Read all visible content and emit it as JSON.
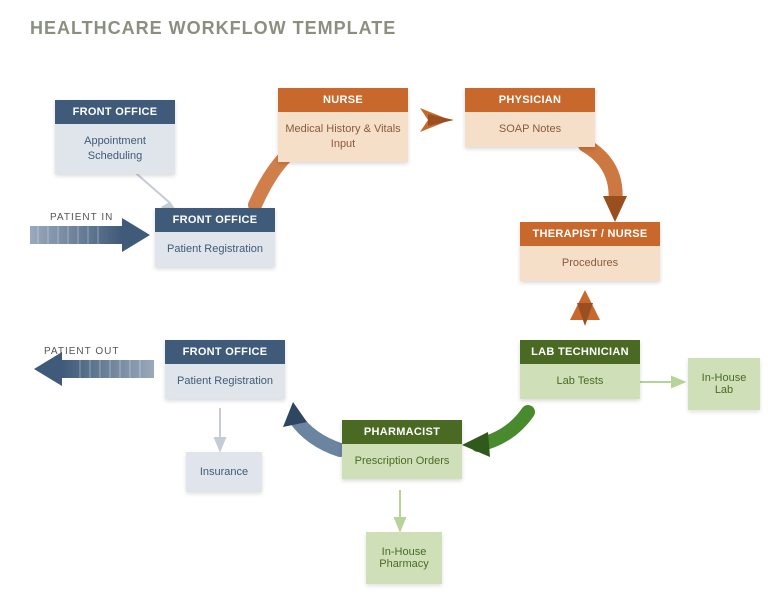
{
  "title": "HEALTHCARE WORKFLOW TEMPLATE",
  "labels": {
    "patient_in": "PATIENT IN",
    "patient_out": "PATIENT OUT"
  },
  "nodes": {
    "fo_appt": {
      "role": "FRONT OFFICE",
      "task": "Appointment Scheduling"
    },
    "fo_reg": {
      "role": "FRONT OFFICE",
      "task": "Patient Registration"
    },
    "nurse": {
      "role": "NURSE",
      "task": "Medical History & Vitals Input"
    },
    "physician": {
      "role": "PHYSICIAN",
      "task": "SOAP Notes"
    },
    "therapist": {
      "role": "THERAPIST / NURSE",
      "task": "Procedures"
    },
    "labtech": {
      "role": "LAB TECHNICIAN",
      "task": "Lab Tests"
    },
    "pharm": {
      "role": "PHARMACIST",
      "task": "Prescription Orders"
    },
    "fo_reg2": {
      "role": "FRONT OFFICE",
      "task": "Patient Registration"
    }
  },
  "aux": {
    "inhouse_lab": "In-House Lab",
    "inhouse_pharm": "In-House Pharmacy",
    "insurance": "Insurance"
  },
  "chart_data": {
    "type": "flowchart",
    "title": "HEALTHCARE WORKFLOW TEMPLATE",
    "entry_label": "PATIENT IN",
    "exit_label": "PATIENT OUT",
    "nodes": [
      {
        "id": "fo_appt",
        "role": "FRONT OFFICE",
        "task": "Appointment Scheduling",
        "group": "blue"
      },
      {
        "id": "fo_reg",
        "role": "FRONT OFFICE",
        "task": "Patient Registration",
        "group": "blue"
      },
      {
        "id": "nurse",
        "role": "NURSE",
        "task": "Medical History & Vitals Input",
        "group": "orange"
      },
      {
        "id": "physician",
        "role": "PHYSICIAN",
        "task": "SOAP Notes",
        "group": "orange"
      },
      {
        "id": "therapist",
        "role": "THERAPIST / NURSE",
        "task": "Procedures",
        "group": "orange"
      },
      {
        "id": "labtech",
        "role": "LAB TECHNICIAN",
        "task": "Lab Tests",
        "group": "green"
      },
      {
        "id": "pharm",
        "role": "PHARMACIST",
        "task": "Prescription Orders",
        "group": "green"
      },
      {
        "id": "fo_reg2",
        "role": "FRONT OFFICE",
        "task": "Patient Registration",
        "group": "blue"
      },
      {
        "id": "inhouse_lab",
        "role": "",
        "task": "In-House Lab",
        "group": "green-aux"
      },
      {
        "id": "inhouse_pharm",
        "role": "",
        "task": "In-House Pharmacy",
        "group": "green-aux"
      },
      {
        "id": "insurance",
        "role": "",
        "task": "Insurance",
        "group": "blue-aux"
      }
    ],
    "edges": [
      {
        "from": "ENTRY",
        "to": "fo_reg",
        "color": "blue",
        "style": "thick"
      },
      {
        "from": "fo_appt",
        "to": "fo_reg",
        "color": "blue",
        "style": "thin"
      },
      {
        "from": "fo_reg",
        "to": "nurse",
        "color": "orange",
        "style": "curved"
      },
      {
        "from": "nurse",
        "to": "physician",
        "color": "orange",
        "style": "thick"
      },
      {
        "from": "physician",
        "to": "therapist",
        "color": "orange",
        "style": "curved"
      },
      {
        "from": "therapist",
        "to": "labtech",
        "color": "orange",
        "style": "thick"
      },
      {
        "from": "labtech",
        "to": "inhouse_lab",
        "color": "green",
        "style": "thin"
      },
      {
        "from": "labtech",
        "to": "pharm",
        "color": "green",
        "style": "curved"
      },
      {
        "from": "pharm",
        "to": "inhouse_pharm",
        "color": "green",
        "style": "thin"
      },
      {
        "from": "pharm",
        "to": "fo_reg2",
        "color": "blue",
        "style": "curved"
      },
      {
        "from": "fo_reg2",
        "to": "insurance",
        "color": "blue",
        "style": "thin"
      },
      {
        "from": "fo_reg2",
        "to": "EXIT",
        "color": "blue",
        "style": "thick"
      }
    ],
    "colors": {
      "blue": "#3f5b79",
      "orange": "#c8682c",
      "green": "#4a6a24"
    }
  }
}
